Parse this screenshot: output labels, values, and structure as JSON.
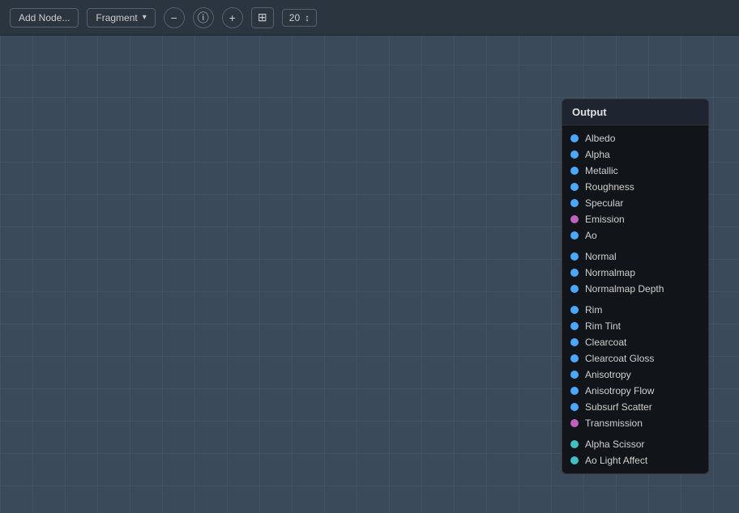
{
  "toolbar": {
    "add_node_label": "Add Node...",
    "fragment_label": "Fragment",
    "zoom_value": "20",
    "icons": {
      "minus": "−",
      "info": "ⓘ",
      "plus": "+",
      "layout": "⊞",
      "spinner": "↕"
    }
  },
  "output_panel": {
    "title": "Output",
    "items": [
      {
        "label": "Albedo",
        "dot_class": "dot-blue"
      },
      {
        "label": "Alpha",
        "dot_class": "dot-blue"
      },
      {
        "label": "Metallic",
        "dot_class": "dot-blue"
      },
      {
        "label": "Roughness",
        "dot_class": "dot-blue"
      },
      {
        "label": "Specular",
        "dot_class": "dot-blue"
      },
      {
        "label": "Emission",
        "dot_class": "dot-pink"
      },
      {
        "label": "Ao",
        "dot_class": "dot-blue"
      },
      {
        "divider": true
      },
      {
        "label": "Normal",
        "dot_class": "dot-blue"
      },
      {
        "label": "Normalmap",
        "dot_class": "dot-blue"
      },
      {
        "label": "Normalmap Depth",
        "dot_class": "dot-blue"
      },
      {
        "divider": true
      },
      {
        "label": "Rim",
        "dot_class": "dot-blue"
      },
      {
        "label": "Rim Tint",
        "dot_class": "dot-blue"
      },
      {
        "label": "Clearcoat",
        "dot_class": "dot-blue"
      },
      {
        "label": "Clearcoat Gloss",
        "dot_class": "dot-blue"
      },
      {
        "label": "Anisotropy",
        "dot_class": "dot-blue"
      },
      {
        "label": "Anisotropy Flow",
        "dot_class": "dot-blue"
      },
      {
        "label": "Subsurf Scatter",
        "dot_class": "dot-blue"
      },
      {
        "label": "Transmission",
        "dot_class": "dot-pink"
      },
      {
        "divider": true
      },
      {
        "label": "Alpha Scissor",
        "dot_class": "dot-teal"
      },
      {
        "label": "Ao Light Affect",
        "dot_class": "dot-teal"
      }
    ]
  }
}
